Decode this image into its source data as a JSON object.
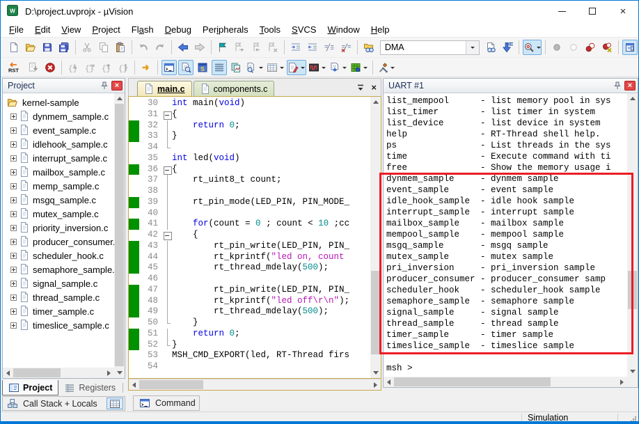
{
  "window": {
    "title": "D:\\project.uvprojx - µVision"
  },
  "menu": {
    "items": [
      {
        "label": "File",
        "accel": 0
      },
      {
        "label": "Edit",
        "accel": 0
      },
      {
        "label": "View",
        "accel": 0
      },
      {
        "label": "Project",
        "accel": 0
      },
      {
        "label": "Flash",
        "accel": 2
      },
      {
        "label": "Debug",
        "accel": 0
      },
      {
        "label": "Peripherals",
        "accel": 3
      },
      {
        "label": "Tools",
        "accel": 0
      },
      {
        "label": "SVCS",
        "accel": 0
      },
      {
        "label": "Window",
        "accel": 0
      },
      {
        "label": "Help",
        "accel": 0
      }
    ]
  },
  "toolbars": {
    "main": {
      "search_value": "DMA",
      "items": [
        {
          "n": "new-file",
          "i": "newfile"
        },
        {
          "n": "open-folder",
          "i": "openfolder"
        },
        {
          "n": "save",
          "i": "save"
        },
        {
          "n": "save-all",
          "i": "saveall"
        },
        {
          "sep": true
        },
        {
          "n": "cut",
          "i": "cut",
          "dis": 1
        },
        {
          "n": "copy",
          "i": "copy",
          "dis": 1
        },
        {
          "n": "paste",
          "i": "paste"
        },
        {
          "sep": true
        },
        {
          "n": "undo",
          "i": "undo",
          "dis": 1
        },
        {
          "n": "redo",
          "i": "redo",
          "dis": 1
        },
        {
          "sep": true
        },
        {
          "n": "navigate-back",
          "i": "back"
        },
        {
          "n": "navigate-forward",
          "i": "fwd",
          "dis": 1
        },
        {
          "sep": true
        },
        {
          "n": "bookmark-toggle",
          "i": "flag"
        },
        {
          "n": "bookmark-next",
          "i": "flagnext",
          "dis": 1
        },
        {
          "n": "bookmark-prev",
          "i": "flagprev",
          "dis": 1
        },
        {
          "n": "bookmark-clear-all",
          "i": "flagclear",
          "dis": 1
        },
        {
          "sep": true
        },
        {
          "n": "indent",
          "i": "indent"
        },
        {
          "n": "outdent",
          "i": "outdent"
        },
        {
          "n": "comment-selection",
          "i": "comment"
        },
        {
          "n": "uncomment-selection",
          "i": "uncomment"
        },
        {
          "sep": true
        },
        {
          "n": "find-in-files",
          "i": "folderfind"
        },
        {
          "combo": "DMA"
        },
        {
          "n": "find-in-files-dialog",
          "i": "findfiles"
        },
        {
          "n": "incremental-find",
          "i": "incfind"
        },
        {
          "sep": true
        },
        {
          "n": "debug-find",
          "i": "dbgfind",
          "hl": 1,
          "dd": 1
        },
        {
          "sep": true
        },
        {
          "n": "breakpoint-toggle",
          "i": "bpgray",
          "dis": 1
        },
        {
          "n": "breakpoint-enable-disable",
          "i": "bpoutline",
          "dis": 1
        },
        {
          "n": "breakpoints-disable-all",
          "i": "bpred"
        },
        {
          "n": "breakpoints-kill-all",
          "i": "bpkill"
        },
        {
          "sep": true
        },
        {
          "n": "configure-options",
          "i": "config",
          "hl": 1
        }
      ]
    },
    "debug": {
      "items": [
        {
          "n": "reset",
          "i": "rst",
          "wide": 1
        },
        {
          "n": "run",
          "i": "run",
          "dis": 1
        },
        {
          "n": "stop",
          "i": "stop"
        },
        {
          "sep": true
        },
        {
          "n": "step-into",
          "i": "step1",
          "dis": 1
        },
        {
          "n": "step-over",
          "i": "step2",
          "dis": 1
        },
        {
          "n": "step-out",
          "i": "step3",
          "dis": 1
        },
        {
          "n": "run-to-cursor",
          "i": "step4",
          "dis": 1
        },
        {
          "sep": true
        },
        {
          "n": "show-next-statement",
          "i": "shownext"
        },
        {
          "sep": true
        },
        {
          "n": "command-window",
          "i": "cmdwin",
          "hl": 1
        },
        {
          "n": "disassembly-window",
          "i": "disasm",
          "hl": 1
        },
        {
          "n": "symbol-window",
          "i": "symbol"
        },
        {
          "n": "serial-windows",
          "i": "serial",
          "hl": 1
        },
        {
          "n": "analysis-windows",
          "i": "analysis"
        },
        {
          "n": "trace-windows",
          "i": "trace",
          "dd": 1
        },
        {
          "n": "memory-windows",
          "i": "memory",
          "dd": 1
        },
        {
          "n": "watch-windows",
          "i": "watch",
          "hl": 1,
          "dd": 1
        },
        {
          "n": "logic-analyzer",
          "i": "logic",
          "dd": 1
        },
        {
          "n": "system-viewer",
          "i": "sysview",
          "dd": 1
        },
        {
          "n": "toolbox",
          "i": "toolbox",
          "dd": 1
        },
        {
          "sep": true
        },
        {
          "n": "debug-tools",
          "i": "tools",
          "dd": 1
        }
      ]
    }
  },
  "project": {
    "title": "Project",
    "root": "kernel-sample",
    "files": [
      "dynmem_sample.c",
      "event_sample.c",
      "idlehook_sample.c",
      "interrupt_sample.c",
      "mailbox_sample.c",
      "memp_sample.c",
      "msgq_sample.c",
      "mutex_sample.c",
      "priority_inversion.c",
      "producer_consumer.c",
      "scheduler_hook.c",
      "semaphore_sample.c",
      "signal_sample.c",
      "thread_sample.c",
      "timer_sample.c",
      "timeslice_sample.c"
    ],
    "tabs": [
      "Project",
      "Registers"
    ],
    "callstack_label": "Call Stack + Locals"
  },
  "editor": {
    "tabs": [
      {
        "label": "main.c",
        "active": true
      },
      {
        "label": "components.c",
        "active": false
      }
    ],
    "lines": [
      {
        "n": 30,
        "f": "none",
        "cov": 0,
        "seg": [
          [
            "k",
            "int"
          ],
          [
            "p",
            " main("
          ],
          [
            "k",
            "void"
          ],
          [
            "p",
            ")"
          ]
        ]
      },
      {
        "n": 31,
        "f": "open",
        "cov": 0,
        "seg": [
          [
            "p",
            "{"
          ]
        ]
      },
      {
        "n": 32,
        "f": "line",
        "cov": 1,
        "seg": [
          [
            "p",
            "    "
          ],
          [
            "k",
            "return"
          ],
          [
            "p",
            " "
          ],
          [
            "n",
            "0"
          ],
          [
            "p",
            ";"
          ]
        ]
      },
      {
        "n": 33,
        "f": "line",
        "cov": 1,
        "seg": [
          [
            "p",
            "}"
          ]
        ]
      },
      {
        "n": 34,
        "f": "end",
        "cov": 0,
        "seg": []
      },
      {
        "n": 35,
        "f": "none",
        "cov": 0,
        "seg": [
          [
            "k",
            "int"
          ],
          [
            "p",
            " led("
          ],
          [
            "k",
            "void"
          ],
          [
            "p",
            ")"
          ]
        ]
      },
      {
        "n": 36,
        "f": "open",
        "cov": 1,
        "seg": [
          [
            "p",
            "{"
          ]
        ]
      },
      {
        "n": 37,
        "f": "line",
        "cov": 0,
        "seg": [
          [
            "p",
            "    rt_uint8_t count;"
          ]
        ]
      },
      {
        "n": 38,
        "f": "line",
        "cov": 0,
        "seg": []
      },
      {
        "n": 39,
        "f": "line",
        "cov": 1,
        "seg": [
          [
            "p",
            "    rt_pin_mode(LED_PIN, PIN_MODE_"
          ]
        ]
      },
      {
        "n": 40,
        "f": "line",
        "cov": 0,
        "seg": []
      },
      {
        "n": 41,
        "f": "line",
        "cov": 1,
        "seg": [
          [
            "p",
            "    "
          ],
          [
            "k",
            "for"
          ],
          [
            "p",
            "(count = "
          ],
          [
            "n",
            "0"
          ],
          [
            "p",
            " ; count < "
          ],
          [
            "n",
            "10"
          ],
          [
            "p",
            " ;cc"
          ]
        ]
      },
      {
        "n": 42,
        "f": "open",
        "cov": 0,
        "seg": [
          [
            "p",
            "    {"
          ]
        ]
      },
      {
        "n": 43,
        "f": "line",
        "cov": 1,
        "seg": [
          [
            "p",
            "        rt_pin_write(LED_PIN, PIN_"
          ]
        ]
      },
      {
        "n": 44,
        "f": "line",
        "cov": 1,
        "seg": [
          [
            "p",
            "        rt_kprintf("
          ],
          [
            "s",
            "\"led on, count"
          ]
        ]
      },
      {
        "n": 45,
        "f": "line",
        "cov": 1,
        "seg": [
          [
            "p",
            "        rt_thread_mdelay("
          ],
          [
            "n",
            "500"
          ],
          [
            "p",
            ");"
          ]
        ]
      },
      {
        "n": 46,
        "f": "line",
        "cov": 0,
        "seg": []
      },
      {
        "n": 47,
        "f": "line",
        "cov": 1,
        "seg": [
          [
            "p",
            "        rt_pin_write(LED_PIN, PIN_"
          ]
        ]
      },
      {
        "n": 48,
        "f": "line",
        "cov": 1,
        "seg": [
          [
            "p",
            "        rt_kprintf("
          ],
          [
            "s",
            "\"led off\\r\\n\""
          ],
          [
            "p",
            ");"
          ]
        ]
      },
      {
        "n": 49,
        "f": "line",
        "cov": 1,
        "seg": [
          [
            "p",
            "        rt_thread_mdelay("
          ],
          [
            "n",
            "500"
          ],
          [
            "p",
            ");"
          ]
        ]
      },
      {
        "n": 50,
        "f": "end",
        "cov": 0,
        "seg": [
          [
            "p",
            "    }"
          ]
        ]
      },
      {
        "n": 51,
        "f": "line",
        "cov": 1,
        "seg": [
          [
            "p",
            "    "
          ],
          [
            "k",
            "return"
          ],
          [
            "p",
            " "
          ],
          [
            "n",
            "0"
          ],
          [
            "p",
            ";"
          ]
        ]
      },
      {
        "n": 52,
        "f": "end",
        "cov": 1,
        "seg": [
          [
            "p",
            "}"
          ]
        ]
      },
      {
        "n": 53,
        "f": "none",
        "cov": 0,
        "seg": [
          [
            "p",
            "MSH_CMD_EXPORT(led, RT-Thread firs"
          ]
        ]
      },
      {
        "n": 54,
        "f": "none",
        "cov": 0,
        "seg": []
      }
    ]
  },
  "uart": {
    "title": "UART #1",
    "lines": [
      "list_mempool      - list memory pool in sys",
      "list_timer        - list timer in system",
      "list_device       - list device in system",
      "help              - RT-Thread shell help.",
      "ps                - List threads in the sys",
      "time              - Execute command with ti",
      "free              - Show the memory usage i",
      "dynmem_sample     - dynmem sample",
      "event_sample      - event sample",
      "idle_hook_sample  - idle hook sample",
      "interrupt_sample  - interrupt sample",
      "mailbox_sample    - mailbox sample",
      "mempool_sample    - mempool sample",
      "msgq_sample       - msgq sample",
      "mutex_sample      - mutex sample",
      "pri_inversion     - pri_inversion sample",
      "producer_consumer - producer_consumer samp",
      "scheduler_hook    - scheduler_hook sample",
      "semaphore_sample  - semaphore sample",
      "signal_sample     - signal sample",
      "thread_sample     - thread sample",
      "timer_sample      - timer sample",
      "timeslice_sample  - timeslice sample",
      "",
      "msh >"
    ]
  },
  "command_tab": {
    "label": "Command"
  },
  "status_bar": {
    "mode": "Simulation"
  }
}
